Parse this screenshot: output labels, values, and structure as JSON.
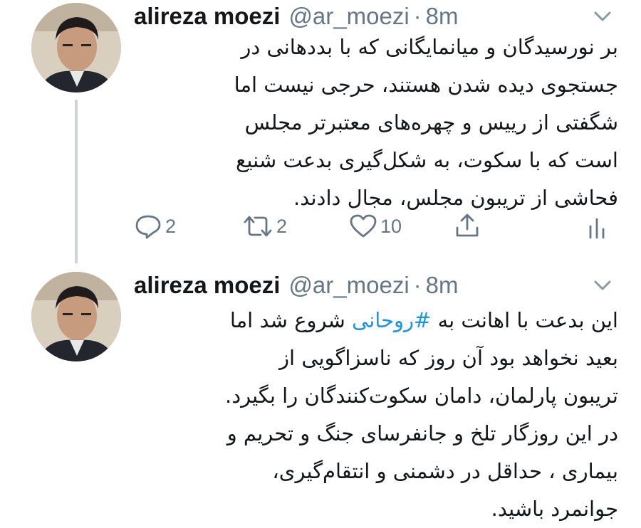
{
  "tweets": [
    {
      "author_name": "alireza moezi",
      "handle": "@ar_moezi",
      "separator": "·",
      "time": "8m",
      "lines": [
        "بر نورسیدگان و  میانمایگانی که با بددهانی در",
        "جستجوی دیده شدن هستند، حرجی نیست اما",
        "شگفتی از رییس و چهره‌های معتبرتر مجلس",
        "است که با سکوت، به شکل‌گیری بدعت شنیع",
        "فحاشی از تریبون مجلس، مجال دادند."
      ],
      "actions": {
        "reply_count": "2",
        "retweet_count": "2",
        "like_count": "10"
      },
      "icons": [
        "reply-icon",
        "retweet-icon",
        "like-icon",
        "share-icon",
        "analytics-icon",
        "chevron-down-icon"
      ]
    },
    {
      "author_name": "alireza moezi",
      "handle": "@ar_moezi",
      "separator": "·",
      "time": "8m",
      "line1_before": "این بدعت با اهانت به ",
      "hashtag": "#روحانی",
      "line1_after": " شروع شد اما",
      "lines": [
        "بعید نخواهد بود  آن روز که ناسزاگویی از",
        "تریبون پارلمان، دامان سکوت‌کنندگان را بگیرد.",
        "در این روزگار تلخ و جانفرسای جنگ و تحریم و",
        "بیماری ، حداقل در دشمنی و انتقام‌گیری،",
        "جوانمرد باشید."
      ]
    }
  ],
  "colors": {
    "link": "#1b95e0",
    "secondary_text": "#657786",
    "thread_line": "#d0d4d8"
  }
}
